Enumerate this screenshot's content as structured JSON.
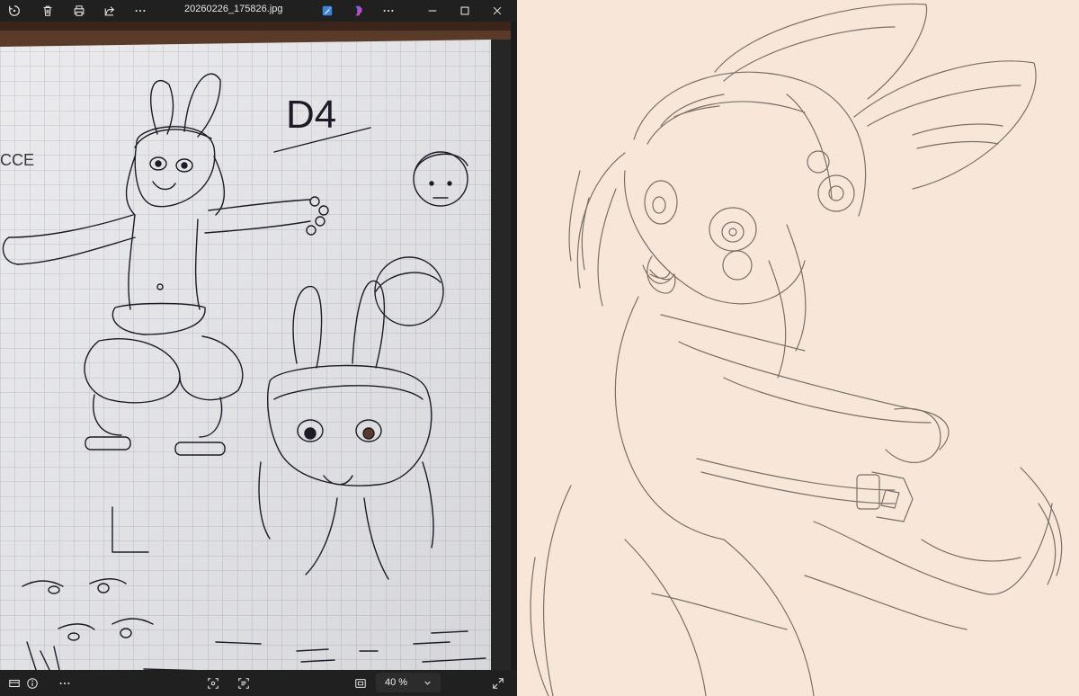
{
  "window": {
    "filename": "20260226_175826.jpg"
  },
  "toolbar": {
    "left_icons": [
      "rotate-icon",
      "delete-icon",
      "print-icon",
      "share-icon",
      "more-icon"
    ],
    "right_icons": [
      "edit-icon",
      "copilot-icon",
      "more-icon"
    ]
  },
  "window_controls": [
    "minimize-icon",
    "maximize-icon",
    "close-icon"
  ],
  "statusbar": {
    "zoom": "40 %"
  },
  "photo_text": {
    "title": "D4",
    "partial_left": "CCE"
  },
  "colors": {
    "viewer_bg": "#202020",
    "paper": "#e9e9ea",
    "grid": "#b9bcc4",
    "ink": "#1e1a28",
    "canvas_bg": "#f8e7d9",
    "sketch_line": "#7a7068"
  }
}
